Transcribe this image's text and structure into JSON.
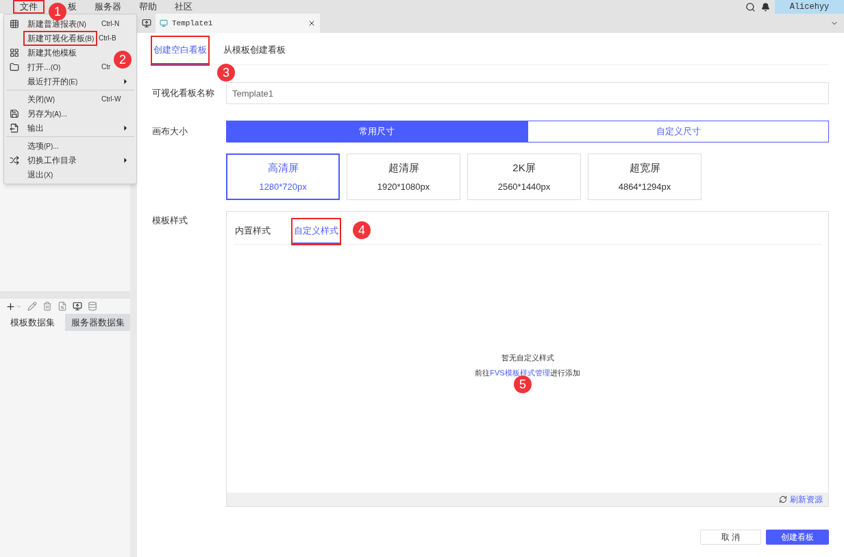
{
  "menubar": {
    "items": [
      {
        "label": "文件",
        "highlighted": true
      },
      {
        "label": "板",
        "highlighted": false
      },
      {
        "label": "服务器",
        "highlighted": false
      },
      {
        "label": "帮助",
        "highlighted": false
      },
      {
        "label": "社区",
        "highlighted": false
      }
    ],
    "user": "Alicehyy"
  },
  "file_menu": {
    "items": [
      {
        "kind": "item",
        "label": "新建普通报表",
        "mnemonic": "(N)",
        "shortcut": "Ctrl-N",
        "submenu": false,
        "highlighted": false
      },
      {
        "kind": "item",
        "label": "新建可视化看板",
        "mnemonic": "(B)",
        "shortcut": "Ctrl-B",
        "submenu": false,
        "highlighted": true
      },
      {
        "kind": "item",
        "label": "新建其他模板",
        "submenu": false,
        "highlighted": false
      },
      {
        "kind": "item",
        "label": "打开...",
        "mnemonic": "(O)",
        "shortcut": "Ctr",
        "submenu": false,
        "highlighted": false
      },
      {
        "kind": "item",
        "label": "最近打开的",
        "mnemonic": "(E)",
        "submenu": true,
        "highlighted": false
      },
      {
        "kind": "separator"
      },
      {
        "kind": "item",
        "label": "关闭",
        "mnemonic": "(W)",
        "shortcut": "Ctrl-W",
        "submenu": false,
        "highlighted": false
      },
      {
        "kind": "item",
        "label": "另存为",
        "mnemonic": "(A)...",
        "submenu": false,
        "highlighted": false
      },
      {
        "kind": "item",
        "label": "输出",
        "submenu": true,
        "highlighted": false
      },
      {
        "kind": "separator"
      },
      {
        "kind": "item",
        "label": "选项",
        "mnemonic": "(P)...",
        "submenu": false,
        "highlighted": false
      },
      {
        "kind": "item",
        "label": "切换工作目录",
        "submenu": true,
        "highlighted": false
      },
      {
        "kind": "item",
        "label": "退出",
        "mnemonic": "(X)",
        "submenu": false,
        "highlighted": false
      }
    ]
  },
  "left_panel": {
    "tabs": [
      {
        "label": "模板数据集",
        "selected": true
      },
      {
        "label": "服务器数据集",
        "selected": false
      }
    ]
  },
  "doc_tab": {
    "title": "Template1"
  },
  "page_tabs": [
    {
      "label": "创建空白看板",
      "selected": true,
      "highlighted": true
    },
    {
      "label": "从模板创建看板",
      "selected": false,
      "highlighted": false
    }
  ],
  "form": {
    "name_label": "可视化看板名称",
    "name_value": "Template1",
    "size_label": "画布大小",
    "size_modes": [
      {
        "label": "常用尺寸",
        "selected": true
      },
      {
        "label": "自定义尺寸",
        "selected": false
      }
    ],
    "presets": [
      {
        "name": "高清屏",
        "size": "1280*720px",
        "selected": true
      },
      {
        "name": "超清屏",
        "size": "1920*1080px",
        "selected": false
      },
      {
        "name": "2K屏",
        "size": "2560*1440px",
        "selected": false
      },
      {
        "name": "超宽屏",
        "size": "4864*1294px",
        "selected": false
      }
    ],
    "style_label": "模板样式",
    "style_tabs": [
      {
        "label": "内置样式",
        "selected": false,
        "highlighted": false
      },
      {
        "label": "自定义样式",
        "selected": true,
        "highlighted": true
      }
    ],
    "empty_title": "暂无自定义样式",
    "empty_prefix": "前往",
    "empty_link": "FVS模板样式管理",
    "empty_suffix": "进行添加",
    "refresh": "刷新资源"
  },
  "buttons": [
    {
      "label": "取 消",
      "kind": "secondary"
    },
    {
      "label": "创建看板",
      "kind": "primary"
    }
  ],
  "annotations": [
    "1",
    "2",
    "3",
    "4",
    "5"
  ]
}
